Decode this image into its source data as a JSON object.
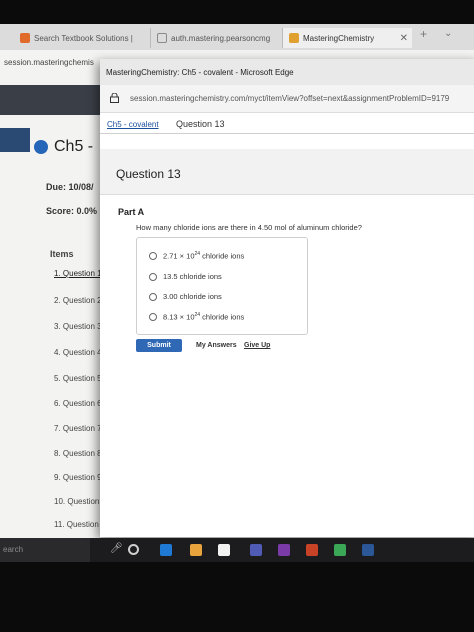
{
  "tabs": [
    {
      "label": "Search Textbook Solutions |",
      "icon": "chegg-icon",
      "color": "#e06b2b"
    },
    {
      "label": "auth.mastering.pearsoncmg",
      "icon": "page-icon",
      "color": "#8a8a8a"
    },
    {
      "label": "MasteringChemistry",
      "icon": "mastering-icon",
      "color": "#e0a030"
    }
  ],
  "tab_close": "✕",
  "new_tab": "+",
  "tab_menu": "⌄",
  "background_page": {
    "url_fragment": "session.masteringchemis",
    "course_title": "Ch5 -",
    "due": "Due: 10/08/",
    "score": "Score: 0.0%",
    "items_heading": "Items",
    "items": [
      "1. Question 1",
      "2. Question 2",
      "3. Question 3",
      "4. Question 4",
      "5. Question 5",
      "6. Question 6",
      "7. Question 7",
      "8. Question 8",
      "9. Question 9",
      "10. Question",
      "11. Question"
    ]
  },
  "popup": {
    "window_title": "MasteringChemistry: Ch5 - covalent - Microsoft Edge",
    "address": "session.masteringchemistry.com/myct/itemView?offset=next&assignmentProblemID=9179",
    "breadcrumb_link": "Ch5 - covalent",
    "breadcrumb_current": "Question 13",
    "question_title": "Question 13",
    "part": "Part A",
    "question_text": "How many chloride ions are there in 4.50 mol of aluminum chloride?",
    "choices": [
      {
        "base": "2.71 × 10",
        "exp": "24",
        "unit": " chloride ions"
      },
      {
        "base": "13.5 chloride ions",
        "exp": "",
        "unit": ""
      },
      {
        "base": "3.00 chloride ions",
        "exp": "",
        "unit": ""
      },
      {
        "base": "8.13 × 10",
        "exp": "24",
        "unit": " chloride ions"
      }
    ],
    "submit_label": "Submit",
    "my_answers_label": "My Answers",
    "give_up_label": "Give Up"
  },
  "taskbar": {
    "search_text": "earch",
    "icons": [
      {
        "name": "edge-icon",
        "color": "#1f7ad6"
      },
      {
        "name": "store-icon",
        "color": "#e8a33d"
      },
      {
        "name": "mail-icon",
        "color": "#f2f2f2"
      },
      {
        "name": "teams-icon",
        "color": "#4f5bb5"
      },
      {
        "name": "onenote-icon",
        "color": "#7a3aa8"
      },
      {
        "name": "powerpoint-icon",
        "color": "#c84326"
      },
      {
        "name": "chrome-icon",
        "color": "#3aa757"
      },
      {
        "name": "word-icon",
        "color": "#2b5797"
      }
    ]
  }
}
